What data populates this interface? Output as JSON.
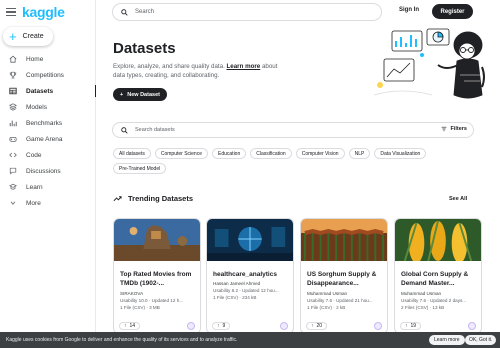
{
  "app": {
    "logo": "kaggle"
  },
  "sidebar": {
    "create_label": "Create",
    "items": [
      {
        "label": "Home",
        "icon": "home-icon"
      },
      {
        "label": "Competitions",
        "icon": "trophy-icon"
      },
      {
        "label": "Datasets",
        "icon": "table-icon",
        "active": true
      },
      {
        "label": "Models",
        "icon": "models-icon"
      },
      {
        "label": "Benchmarks",
        "icon": "benchmark-icon"
      },
      {
        "label": "Game Arena",
        "icon": "game-icon"
      },
      {
        "label": "Code",
        "icon": "code-icon"
      },
      {
        "label": "Discussions",
        "icon": "discussion-icon"
      },
      {
        "label": "Learn",
        "icon": "learn-icon"
      },
      {
        "label": "More",
        "icon": "chevron-down-icon"
      }
    ]
  },
  "header": {
    "search_placeholder": "Search",
    "signin_label": "Sign In",
    "register_label": "Register"
  },
  "hero": {
    "title": "Datasets",
    "description_1": "Explore, analyze, and share quality data. ",
    "learn_more": "Learn more",
    "description_2": " about data types, creating, and collaborating.",
    "new_dataset_label": "New Dataset"
  },
  "dataset_search": {
    "placeholder": "Search datasets",
    "filters_label": "Filters"
  },
  "chips": [
    "All datasets",
    "Computer Science",
    "Education",
    "Classification",
    "Computer Vision",
    "NLP",
    "Data Visualization",
    "Pre-Trained Model"
  ],
  "trending": {
    "title": "Trending Datasets",
    "see_all": "See All"
  },
  "cards": [
    {
      "title": "Top Rated Movies from TMDb (1902-...",
      "author": "SIRAKOVA",
      "usability": "Usability 10.0 · Updated 12 h...",
      "files": "1 File (CSV) · 3 MB",
      "votes": "14"
    },
    {
      "title": "healthcare_analytics",
      "author": "Hassan Jameel Ahmed",
      "usability": "Usability 8.2 · Updated 12 hou...",
      "files": "1 File (CSV) · 234 kB",
      "votes": "9"
    },
    {
      "title": "US Sorghum Supply & Disappearance...",
      "author": "Muhammad Usman",
      "usability": "Usability 7.6 · Updated 21 hou...",
      "files": "1 File (CSV) · 2 kB",
      "votes": "20"
    },
    {
      "title": "Global Corn Supply & Demand Master...",
      "author": "Muhammad Usman",
      "usability": "Usability 7.6 · Updated 2 days...",
      "files": "2 Files (CSV) · 13 kB",
      "votes": "19"
    }
  ],
  "cookie": {
    "text": "Kaggle uses cookies from Google to deliver and enhance the quality of its services and to analyze traffic.",
    "learn_more": "Learn more",
    "ok": "OK, Got it."
  }
}
